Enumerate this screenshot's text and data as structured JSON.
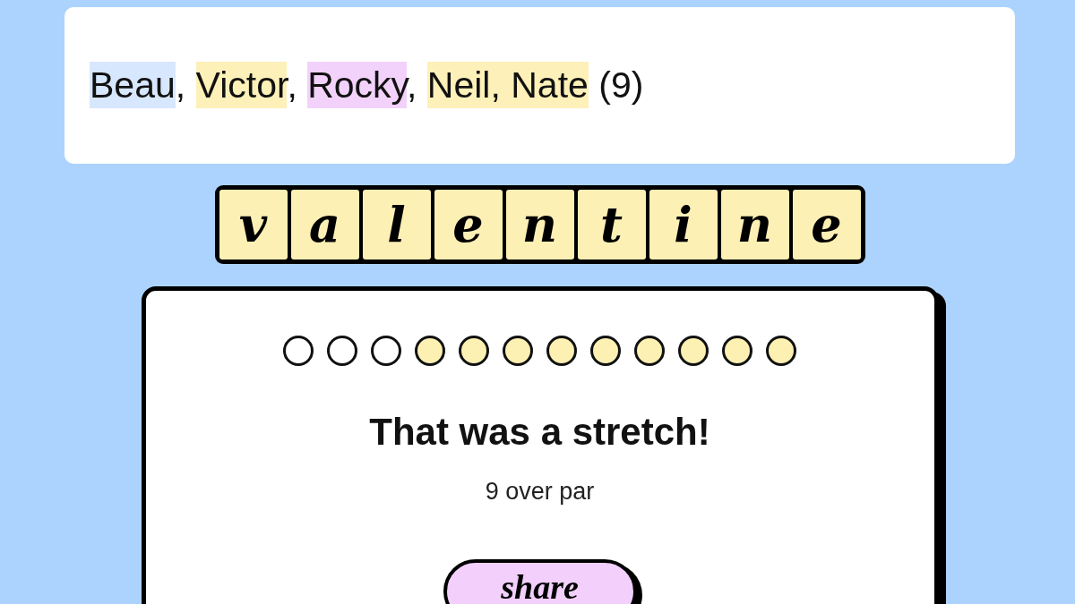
{
  "clue": {
    "segments": [
      {
        "text": "Beau",
        "color": "#d7e7fd"
      },
      {
        "text": ", "
      },
      {
        "text": "Victor",
        "color": "#fdf0b8"
      },
      {
        "text": ", "
      },
      {
        "text": "Rocky",
        "color": "#f2d1fb"
      },
      {
        "text": ", "
      },
      {
        "text": "Neil, Nate",
        "color": "#fdf0b8"
      },
      {
        "text": " (9)"
      }
    ]
  },
  "word": {
    "letters": [
      "v",
      "a",
      "l",
      "e",
      "n",
      "t",
      "i",
      "n",
      "e"
    ]
  },
  "result": {
    "dots": [
      {
        "filled": false
      },
      {
        "filled": false
      },
      {
        "filled": false
      },
      {
        "filled": true
      },
      {
        "filled": true
      },
      {
        "filled": true
      },
      {
        "filled": true
      },
      {
        "filled": true
      },
      {
        "filled": true
      },
      {
        "filled": true
      },
      {
        "filled": true
      },
      {
        "filled": true
      }
    ],
    "title": "That was a stretch!",
    "subtitle": "9 over par",
    "share_button": "share"
  }
}
